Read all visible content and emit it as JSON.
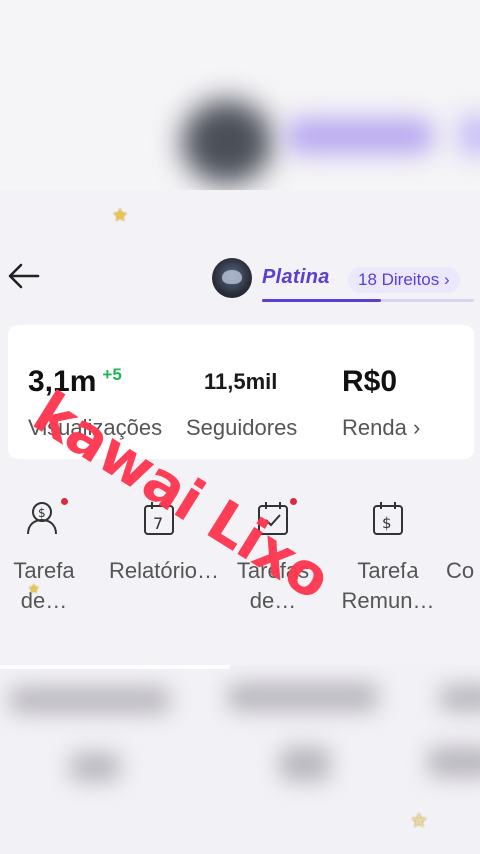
{
  "topbar": {
    "level_name": "Platina",
    "rights_label": "18 Direitos ›",
    "level_progress": 0.56
  },
  "stats": {
    "views_value": "3,1m",
    "views_delta": "+5",
    "views_label": "Visualizações",
    "followers_value": "11,5mil",
    "followers_label": "Seguidores",
    "income_value": "R$0",
    "income_label": "Renda ›"
  },
  "tools": [
    {
      "label": "Tarefa de…",
      "icon": "money-person-icon",
      "has_dot": true
    },
    {
      "label": "Relatório…",
      "icon": "calendar-7-icon",
      "has_dot": false
    },
    {
      "label": "Tarefas de…",
      "icon": "calendar-check-icon",
      "has_dot": true
    },
    {
      "label": "Tarefa Remun…",
      "icon": "calendar-dollar-icon",
      "has_dot": false
    },
    {
      "label": "Co",
      "icon": "",
      "has_dot": false
    }
  ],
  "watermark": "kawai Lixo",
  "colors": {
    "accent": "#5b3fd0",
    "delta_green": "#22b45a",
    "watermark_red": "#ff3650",
    "dot_red": "#e0283c"
  }
}
